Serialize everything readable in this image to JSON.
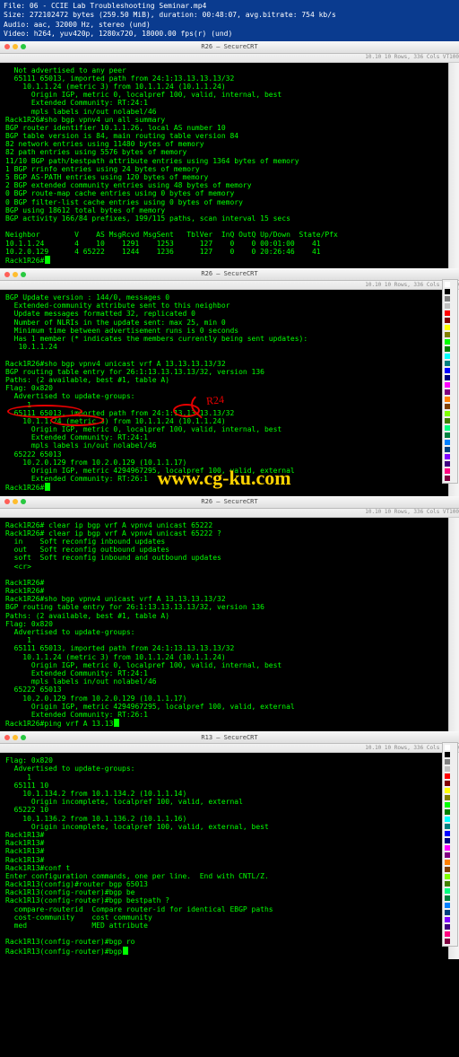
{
  "media_info": {
    "file": "File: 06 - CCIE Lab Troubleshooting Seminar.mp4",
    "size": "Size: 272102472 bytes (259.50 MiB), duration: 00:48:07, avg.bitrate: 754 kb/s",
    "audio": "Audio: aac, 32000 Hz, stereo (und)",
    "video": "Video: h264, yuv420p, 1280x720, 18000.00 fps(r) (und)"
  },
  "titlebar": {
    "title": "R26 — SecureCRT"
  },
  "toolbar": {
    "info": "10.10  10 Rows, 336 Cols  VT100"
  },
  "panel1_lines": [
    "  Not advertised to any peer",
    "  65111 65013, imported path from 24:1:13.13.13.13/32",
    "    10.1.1.24 (metric 3) from 10.1.1.24 (10.1.1.24)",
    "      Origin IGP, metric 0, localpref 100, valid, internal, best",
    "      Extended Community: RT:24:1",
    "      mpls labels in/out nolabel/46",
    "Rack1R26#sho bgp vpnv4 un all summary",
    "BGP router identifier 10.1.1.26, local AS number 10",
    "BGP table version is 84, main routing table version 84",
    "82 network entries using 11480 bytes of memory",
    "82 path entries using 5576 bytes of memory",
    "11/10 BGP path/bestpath attribute entries using 1364 bytes of memory",
    "1 BGP rrinfo entries using 24 bytes of memory",
    "5 BGP AS-PATH entries using 120 bytes of memory",
    "2 BGP extended community entries using 48 bytes of memory",
    "0 BGP route-map cache entries using 0 bytes of memory",
    "0 BGP filter-list cache entries using 0 bytes of memory",
    "BGP using 18612 total bytes of memory",
    "BGP activity 166/84 prefixes, 199/115 paths, scan interval 15 secs",
    "",
    "Neighbor        V    AS MsgRcvd MsgSent   TblVer  InQ OutQ Up/Down  State/Pfx",
    "10.1.1.24       4    10    1291    1253      127    0    0 00:01:00    41",
    "10.2.0.129      4 65222    1244    1236      127    0    0 20:26:46    41",
    "Rack1R26#"
  ],
  "panel2_lines": [
    "BGP Update version : 144/0, messages 0",
    "  Extended-community attribute sent to this neighbor",
    "  Update messages formatted 32, replicated 0",
    "  Number of NLRIs in the update sent: max 25, min 0",
    "  Minimum time between advertisement runs is 0 seconds",
    "  Has 1 member (* indicates the members currently being sent updates):",
    "   10.1.1.24",
    "",
    "Rack1R26#sho bgp vpnv4 unicast vrf A 13.13.13.13/32",
    "BGP routing table entry for 26:1:13.13.13.13/32, version 136",
    "Paths: (2 available, best #1, table A)",
    "Flag: 0x820",
    "  Advertised to update-groups:",
    "     1",
    "  65111 65013, imported path from 24:1:13.13.13.13/32",
    "    10.1.1.24 (metric 3) from 10.1.1.24 (10.1.1.24)",
    "      Origin IGP, metric 0, localpref 100, valid, internal, best",
    "      Extended Community: RT:24:1",
    "      mpls labels in/out nolabel/46",
    "  65222 65013",
    "    10.2.0.129 from 10.2.0.129 (10.1.1.17)",
    "      Origin IGP, metric 4294967295, localpref 100, valid, external",
    "      Extended Community: RT:26:1",
    "Rack1R26#"
  ],
  "panel3_lines": [
    "Rack1R26# clear ip bgp vrf A vpnv4 unicast 65222",
    "Rack1R26# clear ip bgp vrf A vpnv4 unicast 65222 ?",
    "  in    Soft reconfig inbound updates",
    "  out   Soft reconfig outbound updates",
    "  soft  Soft reconfig inbound and outbound updates",
    "  <cr>",
    "",
    "Rack1R26#",
    "Rack1R26#",
    "Rack1R26#sho bgp vpnv4 unicast vrf A 13.13.13.13/32",
    "BGP routing table entry for 26:1:13.13.13.13/32, version 136",
    "Paths: (2 available, best #1, table A)",
    "Flag: 0x820",
    "  Advertised to update-groups:",
    "     1",
    "  65111 65013, imported path from 24:1:13.13.13.13/32",
    "    10.1.1.24 (metric 3) from 10.1.1.24 (10.1.1.24)",
    "      Origin IGP, metric 0, localpref 100, valid, internal, best",
    "      Extended Community: RT:24:1",
    "      mpls labels in/out nolabel/46",
    "  65222 65013",
    "    10.2.0.129 from 10.2.0.129 (10.1.1.17)",
    "      Origin IGP, metric 4294967295, localpref 100, valid, external",
    "      Extended Community: RT:26:1",
    "Rack1R26#ping vrf A 13.13"
  ],
  "panel4_lines": [
    "Flag: 0x820",
    "  Advertised to update-groups:",
    "     1",
    "  65111 10",
    "    10.1.134.2 from 10.1.134.2 (10.1.1.14)",
    "      Origin incomplete, localpref 100, valid, external",
    "  65222 10",
    "    10.1.136.2 from 10.1.136.2 (10.1.1.16)",
    "      Origin incomplete, localpref 100, valid, external, best",
    "Rack1R13#",
    "Rack1R13#",
    "Rack1R13#",
    "Rack1R13#",
    "Rack1R13#conf t",
    "Enter configuration commands, one per line.  End with CNTL/Z.",
    "Rack1R13(config)#router bgp 65013",
    "Rack1R13(config-router)#bgp be",
    "Rack1R13(config-router)#bgp bestpath ?",
    "  compare-routerid  Compare router-id for identical EBGP paths",
    "  cost-community    cost community",
    "  med               MED attribute",
    "",
    "Rack1R13(config-router)#bgp ro",
    "Rack1R13(config-router)#bgp"
  ],
  "watermark": "www.cg-ku.com",
  "annotations": {
    "r24": "R24"
  },
  "palette_colors": [
    "#ffffff",
    "#000000",
    "#808080",
    "#c0c0c0",
    "#ff0000",
    "#800000",
    "#ffff00",
    "#808000",
    "#00ff00",
    "#008000",
    "#00ffff",
    "#008080",
    "#0000ff",
    "#000080",
    "#ff00ff",
    "#800080",
    "#ff8000",
    "#804000",
    "#80ff00",
    "#408000",
    "#00ff80",
    "#008040",
    "#0080ff",
    "#004080",
    "#8000ff",
    "#400080",
    "#ff0080",
    "#800040"
  ]
}
